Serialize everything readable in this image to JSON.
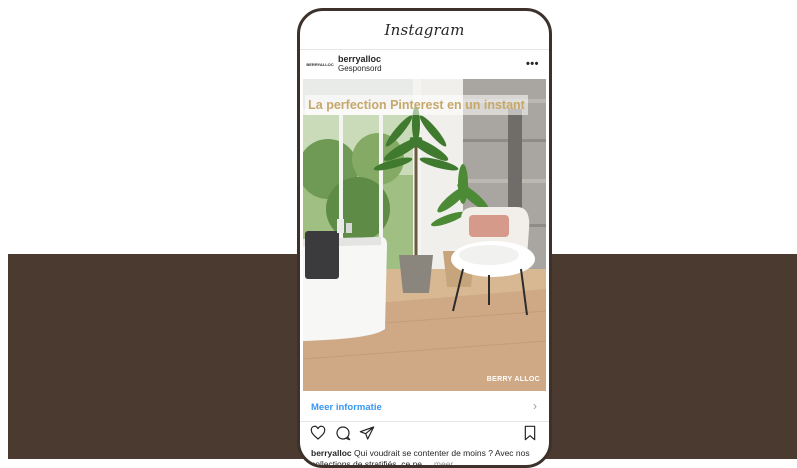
{
  "app": {
    "logo_text": "Instagram"
  },
  "post": {
    "brand_small": "BERRYALLOC",
    "username": "berryalloc",
    "sponsored": "Gesponsord",
    "overlay_headline": "La perfection Pinterest en un instant",
    "watermark": "BERRY ALLOC",
    "cta_label": "Meer informatie",
    "caption_user": "berryalloc",
    "caption_text": "Qui voudrait se contenter de moins ? Avec nos collections de stratifiés, ce ne ...",
    "caption_more": "meer"
  },
  "icons": {
    "more": "more-dots-icon",
    "cta_arrow": "chevron-right-icon",
    "like": "heart-icon",
    "comment": "comment-icon",
    "share": "paper-plane-icon",
    "save": "bookmark-icon"
  },
  "colors": {
    "band": "#4a3a30",
    "phone_frame": "#3d322b",
    "cta_blue": "#3897f0",
    "headline_gold": "#c7a86a"
  }
}
